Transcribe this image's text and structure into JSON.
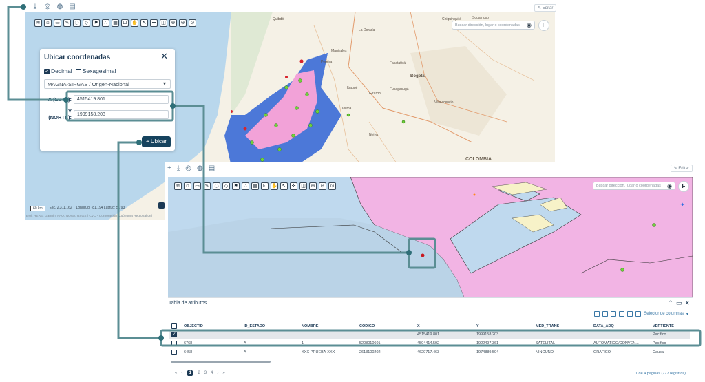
{
  "editar_label": "Editar",
  "map1": {
    "search_placeholder": "Buscar dirección, lugar o coordenadas",
    "f_button": "F",
    "scale": "60 km",
    "scale_text": "Esc. 2.311.162",
    "coords_text": "Longitud: -81.194 Latitud: 5.793",
    "attribution": "Esri, HERE, Garmin, FAO, NOAA, USGS | CVC - Corporación Autónoma Regional del",
    "place_labels": [
      "Quibdó",
      "Chiquinquirá",
      "Sogamoso",
      "La Dorada",
      "Manizales",
      "Pereira",
      "Facatativá",
      "Bogotá",
      "Ibagué",
      "Girardot",
      "Fusagasugá",
      "Villavicencio",
      "Tolima",
      "Neiva",
      "COLOMBIA"
    ]
  },
  "dialog": {
    "title": "Ubicar coordenadas",
    "close": "✕",
    "opt_decimal": "Decimal",
    "opt_sexagesimal": "Sexagesimal",
    "projection": "MAGNA-SIRGAS / Origen-Nacional",
    "x_label": "X (ESTE):",
    "x_value": "4515419.801",
    "y_label": "Y (NORTE):",
    "y_value": "1999158.203",
    "locate_button": "Ubicar"
  },
  "map2": {
    "search_placeholder": "Buscar dirección, lugar o coordenadas",
    "f_button": "F"
  },
  "attr_table": {
    "title": "Tabla de atributos",
    "column_selector": "Selector de columnas",
    "columns": [
      "OBJECTID",
      "ID_ESTADO",
      "NOMBRE",
      "CODIGO",
      "X",
      "Y",
      "MED_TRANS",
      "DATA_ADQ",
      "VERTIENTE"
    ],
    "rows": [
      {
        "checked": true,
        "cells": [
          "",
          "",
          "",
          "",
          "4515419.801",
          "1999158.203",
          "",
          "",
          "Pacífico"
        ]
      },
      {
        "checked": false,
        "cells": [
          "6768",
          "A",
          "1",
          "5208010601",
          "4504414.592",
          "1922497.361",
          "SATELITAL",
          "AUTOMATICO/CONVEN...",
          "Pacífico"
        ]
      },
      {
        "checked": false,
        "cells": [
          "6458",
          "A",
          "XXX-PRUEBA-XXX",
          "2613100202",
          "4629717.463",
          "1974889.504",
          "NINGUNO",
          "GRÁFICO",
          "Cauca"
        ]
      }
    ],
    "pages": [
      "1",
      "2",
      "3",
      "4"
    ],
    "page_info": "1 de 4 páginas (777 registros)"
  },
  "colors": {
    "accent": "#1d3a55",
    "callout": "#5b8e94",
    "sea": "#b9d7ec",
    "highlight_pink": "#f4b6e6"
  }
}
